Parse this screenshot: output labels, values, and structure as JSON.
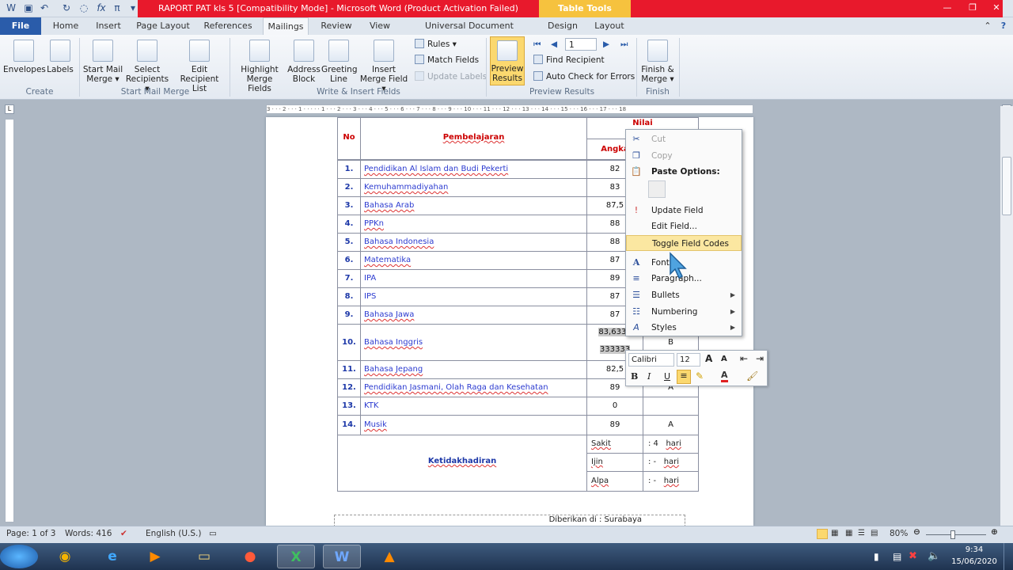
{
  "window": {
    "title": "RAPORT PAT kls 5 [Compatibility Mode]  -  Microsoft Word (Product Activation Failed)",
    "context_tab": "Table Tools"
  },
  "tabs": [
    "File",
    "Home",
    "Insert",
    "Page Layout",
    "References",
    "Mailings",
    "Review",
    "View",
    "Universal Document Converter",
    "Design",
    "Layout"
  ],
  "ribbon": {
    "create": {
      "envelopes": "Envelopes",
      "labels": "Labels",
      "group": "Create"
    },
    "start": {
      "start_mail_merge": "Start Mail Merge",
      "select_recipients": "Select Recipients",
      "edit_recipient_list": "Edit Recipient List",
      "group": "Start Mail Merge"
    },
    "write": {
      "highlight": "Highlight Merge Fields",
      "address_block": "Address Block",
      "greeting_line": "Greeting Line",
      "insert_merge_field": "Insert Merge Field",
      "rules": "Rules",
      "match_fields": "Match Fields",
      "update_labels": "Update Labels",
      "group": "Write & Insert Fields"
    },
    "preview": {
      "preview_results": "Preview Results",
      "record": "1",
      "find_recipient": "Find Recipient",
      "auto_check": "Auto Check for Errors",
      "group": "Preview Results"
    },
    "finish": {
      "finish_merge": "Finish & Merge",
      "group": "Finish"
    }
  },
  "ruler": {
    "marks": "3 · · · 2 · · · 1 · · · · · 1 · · · 2 · · · 3 · · · 4 · · · 5 · · · 6 · · · 7 · · · 8 · · · 9 · · · 10 · · · 11 · · · 12 · · · 13 · · · 14 · · · 15 · · · 16 · · · 17 · · · 18"
  },
  "table": {
    "header": {
      "no": "No",
      "subject": "Pembelajaran",
      "nilai": "Nilai",
      "angka": "Angka"
    },
    "rows": [
      {
        "no": "1.",
        "subject": "Pendidikan Al Islam dan Budi Pekerti",
        "angka": "82",
        "predikat": ""
      },
      {
        "no": "2.",
        "subject": "Kemuhammadiyahan",
        "angka": "83",
        "predikat": ""
      },
      {
        "no": "3.",
        "subject": "Bahasa Arab",
        "angka": "87,5",
        "predikat": ""
      },
      {
        "no": "4.",
        "subject": "PPKn",
        "angka": "88",
        "predikat": ""
      },
      {
        "no": "5.",
        "subject": "Bahasa Indonesia",
        "angka": "88",
        "predikat": ""
      },
      {
        "no": "6.",
        "subject": "Matematika",
        "angka": "87",
        "predikat": ""
      },
      {
        "no": "7.",
        "subject": "IPA",
        "angka": "89",
        "predikat": ""
      },
      {
        "no": "8.",
        "subject": "IPS",
        "angka": "87",
        "predikat": ""
      },
      {
        "no": "9.",
        "subject": "Bahasa Jawa",
        "angka": "87",
        "predikat": ""
      },
      {
        "no": "10.",
        "subject": "Bahasa Inggris",
        "angka": "83,6333",
        "angka2": "333333",
        "predikat": "B"
      },
      {
        "no": "11.",
        "subject": "Bahasa Jepang",
        "angka": "82,5",
        "predikat": ""
      },
      {
        "no": "12.",
        "subject": "Pendidikan Jasmani, Olah Raga dan Kesehatan",
        "angka": "89",
        "predikat": "A"
      },
      {
        "no": "13.",
        "subject": "KTK",
        "angka": "0",
        "predikat": ""
      },
      {
        "no": "14.",
        "subject": "Musik",
        "angka": "89",
        "predikat": "A"
      }
    ],
    "attendance": {
      "label": "Ketidakhadiran",
      "items": [
        {
          "label": "Sakit",
          "value": ": 4",
          "unit": "hari"
        },
        {
          "label": "Ijin",
          "value": ": -",
          "unit": "hari"
        },
        {
          "label": "Alpa",
          "value": ": -",
          "unit": "hari"
        }
      ]
    },
    "footer": "Diberikan di :  Surabaya"
  },
  "context_menu": {
    "cut": "Cut",
    "copy": "Copy",
    "paste_options": "Paste Options:",
    "update_field": "Update Field",
    "edit_field": "Edit Field...",
    "toggle_field_codes": "Toggle Field Codes",
    "font": "Font...",
    "paragraph": "Paragraph...",
    "bullets": "Bullets",
    "numbering": "Numbering",
    "styles": "Styles"
  },
  "mini_toolbar": {
    "font": "Calibri",
    "size": "12"
  },
  "status": {
    "page": "Page: 1 of 3",
    "words": "Words: 416",
    "language": "English (U.S.)",
    "zoom": "80%"
  },
  "taskbar": {
    "time": "9:34",
    "date": "15/06/2020"
  }
}
